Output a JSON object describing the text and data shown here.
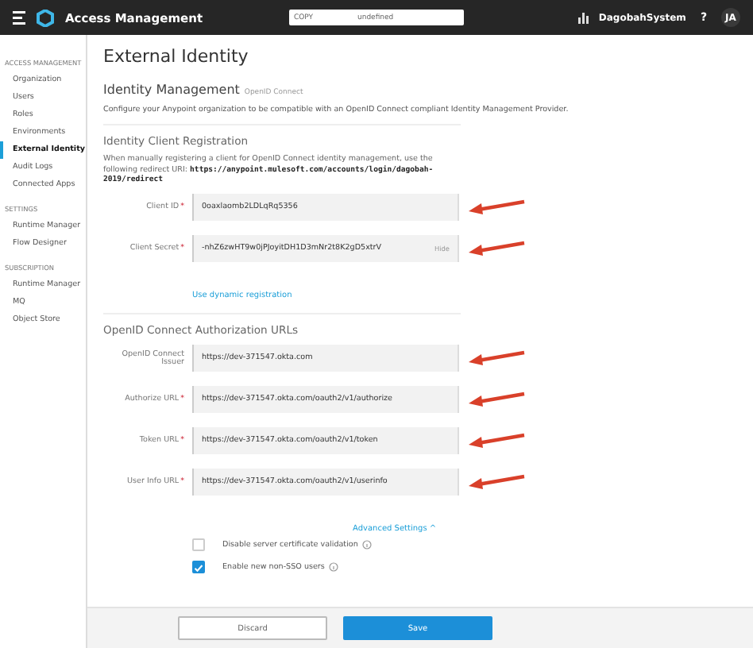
{
  "topbar": {
    "app_title": "Access Management",
    "copy_field": {
      "label": "COPY",
      "value": "undefined"
    },
    "org": "DagobahSystem",
    "help": "?",
    "avatar": "JA"
  },
  "sidebar": {
    "sections": [
      {
        "title": "ACCESS MANAGEMENT",
        "items": [
          {
            "label": "Organization",
            "selected": false
          },
          {
            "label": "Users",
            "selected": false
          },
          {
            "label": "Roles",
            "selected": false
          },
          {
            "label": "Environments",
            "selected": false
          },
          {
            "label": "External Identity",
            "selected": true
          },
          {
            "label": "Audit Logs",
            "selected": false
          },
          {
            "label": "Connected Apps",
            "selected": false
          }
        ]
      },
      {
        "title": "SETTINGS",
        "items": [
          {
            "label": "Runtime Manager",
            "selected": false
          },
          {
            "label": "Flow Designer",
            "selected": false
          }
        ]
      },
      {
        "title": "SUBSCRIPTION",
        "items": [
          {
            "label": "Runtime Manager",
            "selected": false
          },
          {
            "label": "MQ",
            "selected": false
          },
          {
            "label": "Object Store",
            "selected": false
          }
        ]
      }
    ]
  },
  "page_title": "External Identity",
  "identity_management": {
    "title": "Identity Management",
    "subtitle": "OpenID Connect",
    "description": "Configure your Anypoint organization to be compatible with an OpenID Connect compliant Identity Management Provider."
  },
  "client_registration": {
    "title": "Identity Client Registration",
    "note": "When manually registering a client for OpenID Connect identity management, use the following redirect URI: **https://anypoint.mulesoft.com/accounts/login/dagobah-2019/redirect**",
    "fields": [
      {
        "label": "Client ID",
        "required_mark": "*",
        "value": "0oaxlaomb2LDLqRq5356",
        "annotated": true
      },
      {
        "label": "Client Secret",
        "required_mark": "*",
        "value": "-nhZ6zwHT9w0jPJoyitDH1D3mNr2t8K2gD5xtrV",
        "action": "Hide",
        "annotated": true
      }
    ],
    "link": "Use dynamic registration"
  },
  "authorization_urls": {
    "title": "OpenID Connect Authorization URLs",
    "fields": [
      {
        "label": "OpenID Connect Issuer",
        "value": "https://dev-371547.okta.com",
        "annotated": true
      },
      {
        "label": "Authorize URL",
        "required_mark": "*",
        "value": "https://dev-371547.okta.com/oauth2/v1/authorize",
        "annotated": true
      },
      {
        "label": "Token URL",
        "required_mark": "*",
        "value": "https://dev-371547.okta.com/oauth2/v1/token",
        "annotated": true
      },
      {
        "label": "User Info URL",
        "required_mark": "*",
        "value": "https://dev-371547.okta.com/oauth2/v1/userinfo",
        "annotated": true
      }
    ]
  },
  "advanced_link": "Advanced Settings ^",
  "options": [
    {
      "label": "Disable server certificate validation",
      "checked": false
    },
    {
      "label": "Enable new non-SSO users",
      "checked": true
    }
  ],
  "footer": {
    "buttons": [
      {
        "label": "Discard",
        "kind": "secondary"
      },
      {
        "label": "Save",
        "kind": "primary"
      }
    ]
  }
}
